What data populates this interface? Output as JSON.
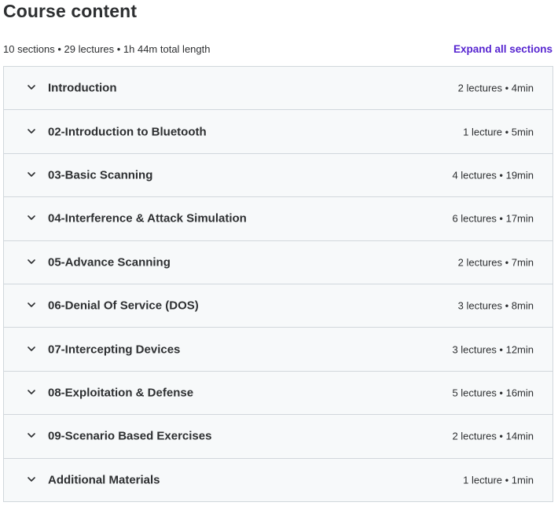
{
  "header": {
    "title": "Course content",
    "summary": "10 sections • 29 lectures • 1h 44m total length",
    "expand_label": "Expand all sections"
  },
  "colors": {
    "accent": "#5624d0",
    "row_bg": "#f7f9fa",
    "border": "#d1d7dc",
    "text": "#2d2f31"
  },
  "sections": [
    {
      "title": "Introduction",
      "meta": "2 lectures • 4min",
      "icon": "chevron-down-icon"
    },
    {
      "title": "02-Introduction to Bluetooth",
      "meta": "1 lecture • 5min",
      "icon": "chevron-down-icon"
    },
    {
      "title": "03-Basic Scanning",
      "meta": "4 lectures • 19min",
      "icon": "chevron-down-icon"
    },
    {
      "title": "04-Interference & Attack Simulation",
      "meta": "6 lectures • 17min",
      "icon": "chevron-down-icon"
    },
    {
      "title": "05-Advance Scanning",
      "meta": "2 lectures • 7min",
      "icon": "chevron-down-icon"
    },
    {
      "title": "06-Denial Of Service (DOS)",
      "meta": "3 lectures • 8min",
      "icon": "chevron-down-icon"
    },
    {
      "title": "07-Intercepting Devices",
      "meta": "3 lectures • 12min",
      "icon": "chevron-down-icon"
    },
    {
      "title": "08-Exploitation & Defense",
      "meta": "5 lectures • 16min",
      "icon": "chevron-down-icon"
    },
    {
      "title": "09-Scenario Based Exercises",
      "meta": "2 lectures • 14min",
      "icon": "chevron-down-icon"
    },
    {
      "title": "Additional Materials",
      "meta": "1 lecture • 1min",
      "icon": "chevron-down-icon"
    }
  ]
}
